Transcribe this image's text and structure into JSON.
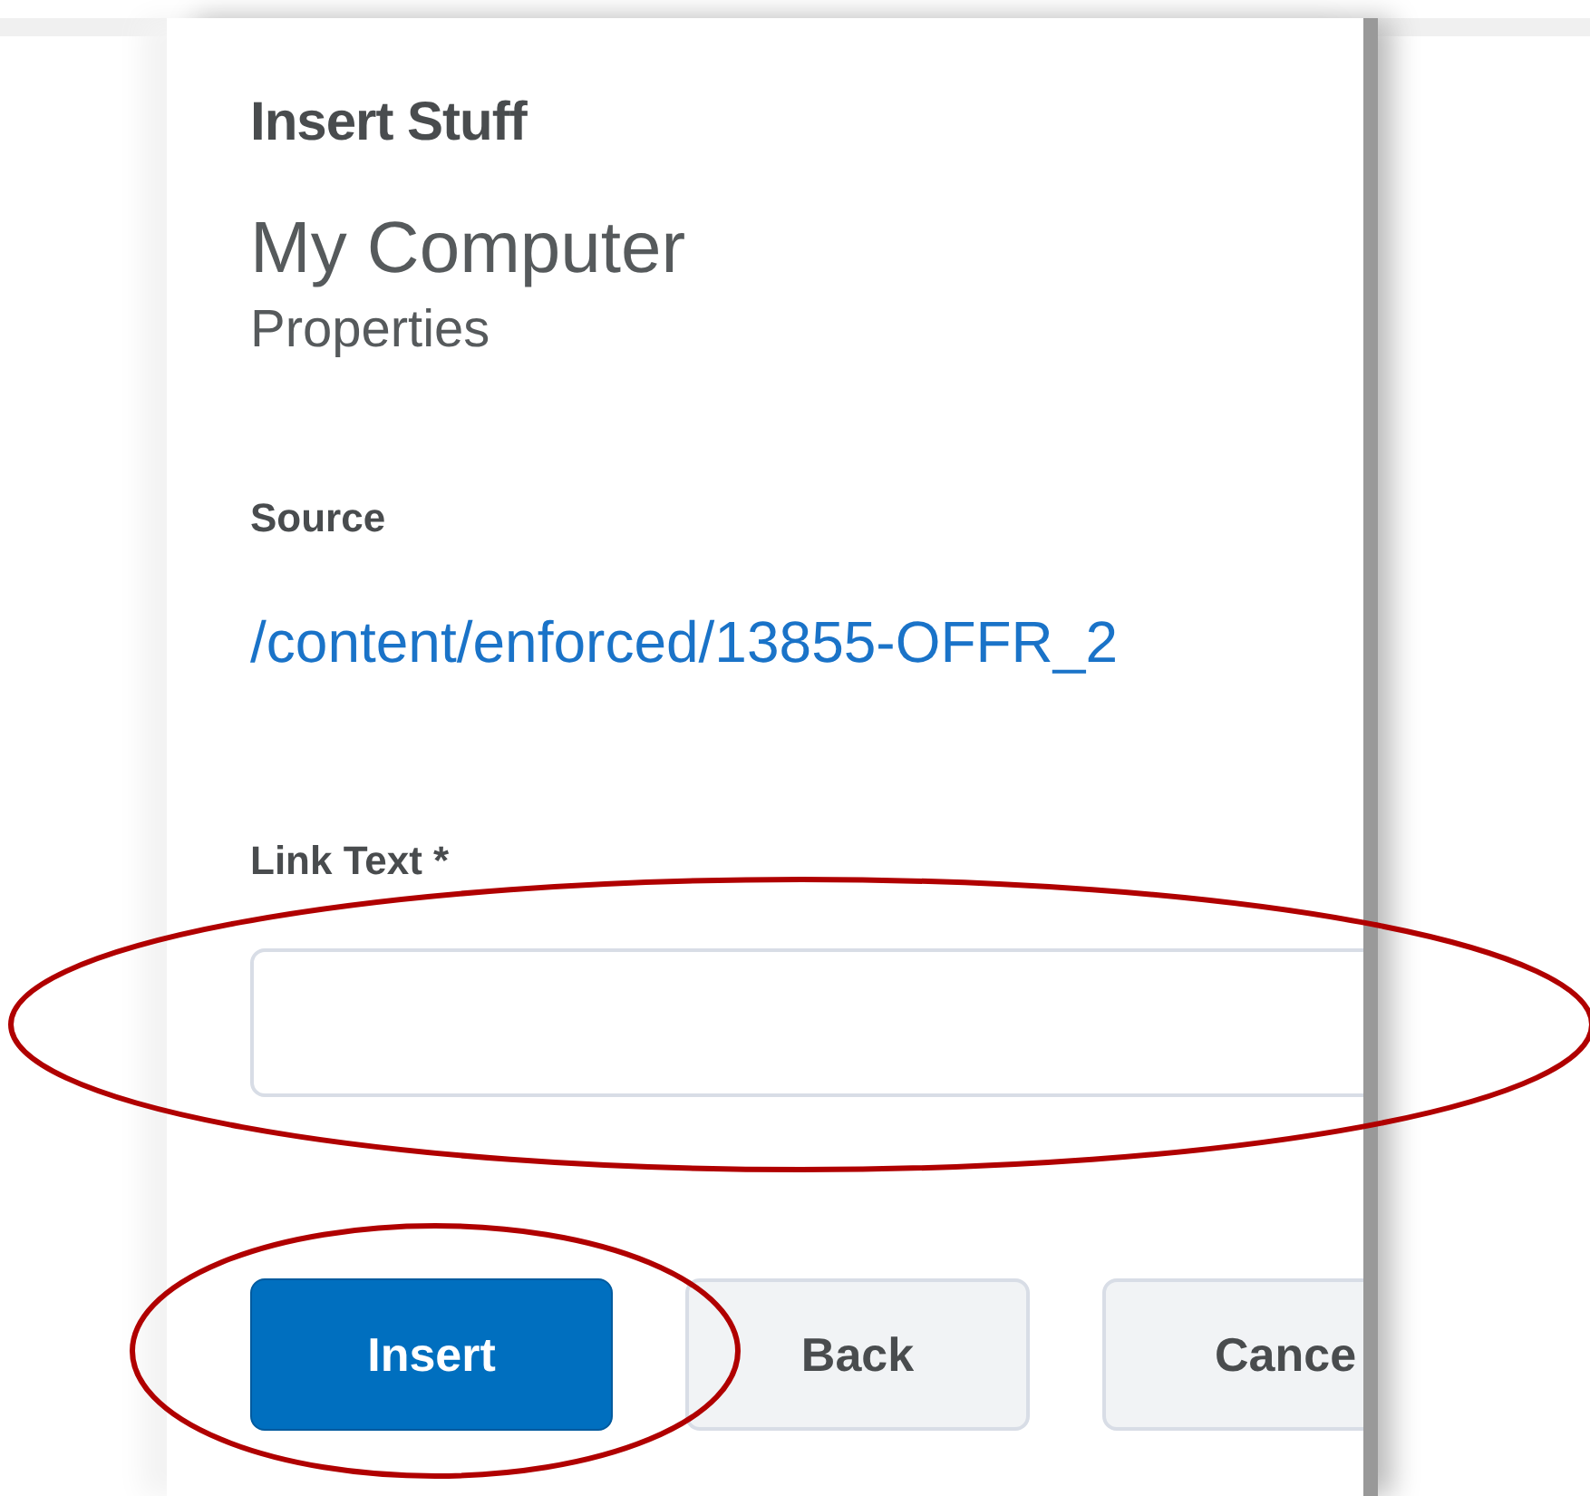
{
  "dialog": {
    "title": "Insert Stuff",
    "heading": "My Computer",
    "subheading": "Properties",
    "source": {
      "label": "Source",
      "link": "/content/enforced/13855-OFFR_2"
    },
    "link_text": {
      "label": "Link Text *"
    },
    "buttons": [
      {
        "label": "Insert",
        "kind": "primary"
      },
      {
        "label": "Back",
        "kind": "secondary"
      },
      {
        "label": "Cance",
        "kind": "secondary"
      }
    ]
  },
  "annotations": [
    {
      "kind": "ellipse"
    },
    {
      "kind": "ellipse"
    }
  ]
}
